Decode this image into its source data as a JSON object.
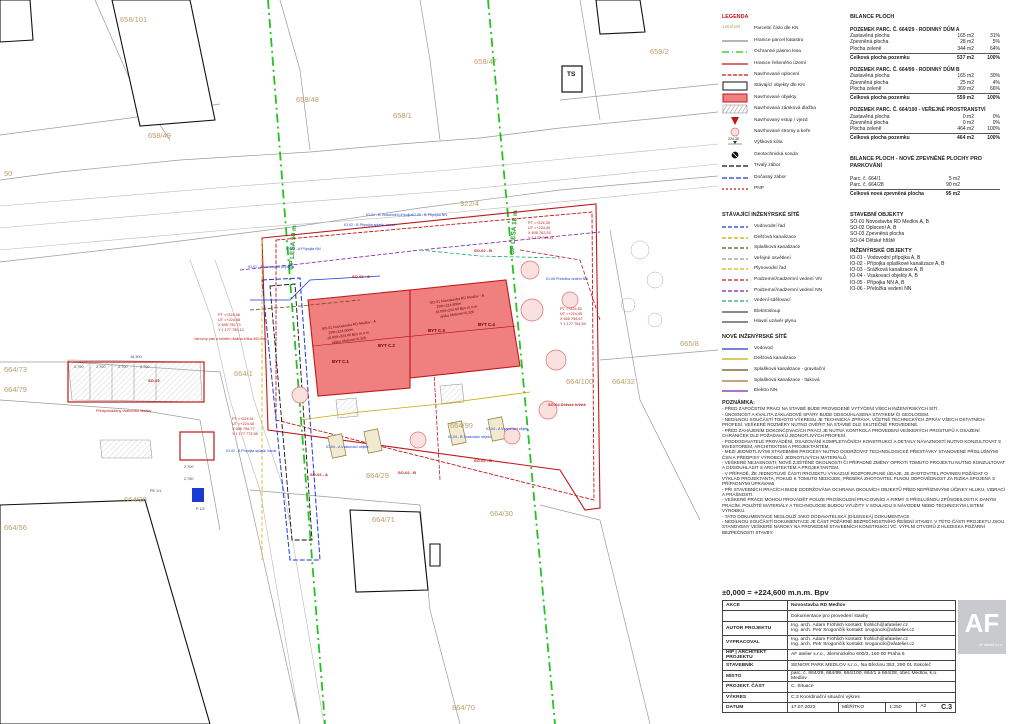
{
  "plan": {
    "parcels": [
      "658/101",
      "658/47",
      "659/2",
      "658/48",
      "658/1",
      "658/49",
      "322/4",
      "664/73",
      "664/79",
      "664/1",
      "664/100",
      "664/32",
      "665/8",
      "664/29",
      "664/99",
      "664/28",
      "664/56",
      "664/71",
      "664/30",
      "664/70"
    ],
    "edge_labels": {
      "left": "50"
    },
    "forest_labels": [
      "OP LESA 50 m",
      "OP LESA 18 m"
    ],
    "ts_label": "TS",
    "building_units": [
      "BYT C.1",
      "BYT C.2",
      "BYT C.3",
      "BYT C.4"
    ],
    "building_a": [
      "SO-01 Novostavba RD Medlov - A",
      "ZPP=224,600m",
      "±0,000=224,60 Bpv m.n.m.",
      "výška hřebene=6,326"
    ],
    "building_b": [
      "SO-01 Novostavba RD Medlov - B",
      "ZPP=224,600m",
      "±0,000=224,60 Bpv m.n.m.",
      "výška hřebene=6,326"
    ],
    "so_labels": [
      "SO-02 - B",
      "SO-02 - A",
      "SO-03",
      "SO-04 Dětské hřiště",
      "SO-02 - A",
      "SO-02 - B",
      "SO-02 - B"
    ],
    "io_labels": [
      "IO-01 - B Vodovodní přípojka",
      "IO-05 - B Přípojka NN",
      "IO-02 - B Přípojka splašk. kanal.",
      "IO-05 - A Přípojka NN",
      "IO-01 - A Vodovodní přípojka",
      "IO-06 Přeložka vedení NN",
      "IO-02 - A Přípojka splašk. kanal.",
      "IO-04 - A Vsakovací objekt",
      "IO-04 - B Vsakovací objekt",
      "IO-04 - A Vsakovací objekt"
    ],
    "coords_left": [
      "PT =+224,56",
      "UT =+224,58",
      "X 605 790,73",
      "Y 1 177 750,10"
    ],
    "coords_top": [
      "PT =+224,35",
      "UT =+224,40",
      "X 605 762,53",
      "Y 1 177 743,41"
    ],
    "coords_right": [
      "PT =+224,52",
      "UT =+224,45",
      "X 605 759,67",
      "Y 1 177 754,59"
    ],
    "coords_bottom": [
      "PT =+224,51",
      "UT =+224,45",
      "X 605 796,77",
      "Y 1 177 773,98"
    ],
    "parking_note": "Varovný pás a reliéfní dlažba šířka 400 mm",
    "parking_note_2": "Předpokládaný vsakovací dlažby",
    "dims": [
      "16,300",
      "2,700",
      "2,700",
      "2,700",
      "2,700",
      "2,700",
      "2,750",
      "PE 1/1",
      "P 1/2"
    ]
  },
  "legend": {
    "title": "LEGENDA",
    "items": [
      {
        "label": "Parcelní číslo dle KN",
        "sym": "text",
        "text": "1203/184"
      },
      {
        "label": "Hranice parcel katastru",
        "sym": "line",
        "color": "#8a8a8a",
        "dash": ""
      },
      {
        "label": "Ochranné pásmo lesa",
        "sym": "line",
        "color": "#22c322",
        "dash": "7 3 1 3"
      },
      {
        "label": "Hranice řešeného území",
        "sym": "line",
        "color": "#c01818",
        "dash": ""
      },
      {
        "label": "Navrhované oplocení",
        "sym": "line",
        "color": "#c01818",
        "dash": "4 1.5"
      },
      {
        "label": "Stávající objekty dle KN",
        "sym": "rect",
        "fill": "#ffffff",
        "stroke": "#111"
      },
      {
        "label": "Navrhované objekty",
        "sym": "rect",
        "fill": "#f08080",
        "stroke": "#c01818"
      },
      {
        "label": "Navrhovaná zámková dlažba",
        "sym": "hatch",
        "color": "#999"
      },
      {
        "label": "Navrhovaný vstup / vjezd",
        "sym": "arrow",
        "color": "#c01818"
      },
      {
        "label": "Navrhované stromy a keře",
        "sym": "tree",
        "color": "#e07070"
      },
      {
        "label": "Výšková kóta",
        "sym": "kota",
        "text": "224,35"
      },
      {
        "label": "Geotechnická sonda",
        "sym": "sonda"
      },
      {
        "label": "Trvalý zábor",
        "sym": "line",
        "color": "#111",
        "dash": "5 2"
      },
      {
        "label": "Dočasný zábor",
        "sym": "line",
        "color": "#1a3ad1",
        "dash": "5 2"
      },
      {
        "label": "PNP",
        "sym": "line",
        "color": "#c01818",
        "dash": "2 2"
      }
    ]
  },
  "balance": {
    "title": "BILANCE PLOCH",
    "groups": [
      {
        "head": "POZEMEK PARC. Č. 664/29 - RODINNÝ DŮM A",
        "rows": [
          [
            "Zastavěná plocha",
            "165 m2",
            "31%"
          ],
          [
            "Zpevněná plocha",
            "28 m2",
            "5%"
          ],
          [
            "Plocha zeleně",
            "344 m2",
            "64%"
          ]
        ],
        "total": [
          "Celková plocha pozemku",
          "537 m2",
          "100%"
        ]
      },
      {
        "head": "POZEMEK PARC. Č. 664/99 - RODINNÝ DŮM B",
        "rows": [
          [
            "Zastavěná plocha",
            "165 m2",
            "30%"
          ],
          [
            "Zpevněná plocha",
            "25 m2",
            "4%"
          ],
          [
            "Plocha zeleně",
            "369 m2",
            "66%"
          ]
        ],
        "total": [
          "Celková plocha pozemku",
          "559 m2",
          "100%"
        ]
      },
      {
        "head": "POZEMEK PARC. Č. 664/100 - VEŘEJNÉ PROSTRANSTVÍ",
        "rows": [
          [
            "Zastavěná plocha",
            "0 m2",
            "0%"
          ],
          [
            "Zpevněná plocha",
            "0 m2",
            "0%"
          ],
          [
            "Plocha zeleně",
            "464 m2",
            "100%"
          ]
        ],
        "total": [
          "Celková plocha pozemku",
          "464 m2",
          "100%"
        ]
      }
    ]
  },
  "parking_balance": {
    "title": "BILANCE PLOCH - NOVÉ ZPEVNĚNÉ PLOCHY PRO PARKOVÁNÍ",
    "rows": [
      [
        "Parc. č. 664/1",
        "5 m2"
      ],
      [
        "Parc. č. 664/28",
        "90 m2"
      ]
    ],
    "total": [
      "Celková nová zpevněná plocha",
      "95 m2"
    ]
  },
  "existing_networks": {
    "title": "STÁVAJÍCÍ INŽENÝRSKÉ SÍTĚ",
    "items": [
      {
        "label": "Vodovodní řad",
        "color": "#1a3ad1",
        "dash": "4 2"
      },
      {
        "label": "Dešťová kanalizace",
        "color": "#c9a800",
        "dash": "4 2"
      },
      {
        "label": "Splašková kanalizace",
        "color": "#6b4b1a",
        "dash": "4 2"
      },
      {
        "label": "Veřejné osvětlení",
        "color": "#999",
        "dash": "4 2"
      },
      {
        "label": "Plynovodní řad",
        "color": "#d8b400",
        "dash": "4 2"
      },
      {
        "label": "Podzemní/nadzemní vedení VN",
        "color": "#c01818",
        "dash": "4 2"
      },
      {
        "label": "Podzemní/nadzemní vedení NN",
        "color": "#7a1fb0",
        "dash": "4 2"
      },
      {
        "label": "Vedení sdělovací",
        "color": "#1fa37a",
        "dash": "4 2"
      },
      {
        "label": "Elektrosloup",
        "color": "#444",
        "dash": ""
      },
      {
        "label": "Hlavní uzávěr plynu",
        "color": "#444",
        "dash": ""
      }
    ]
  },
  "new_networks": {
    "title": "NOVÉ INŽENÝRSKÉ SÍTĚ",
    "items": [
      {
        "label": "Vodovod",
        "color": "#1a3ad1"
      },
      {
        "label": "Dešťová kanalizace",
        "color": "#c9a800"
      },
      {
        "label": "Splašková kanalizace - gravitační",
        "color": "#6b4b1a"
      },
      {
        "label": "Splašková kanalizace - tlaková",
        "color": "#a0702a"
      },
      {
        "label": "Elektro NN",
        "color": "#7a1fb0"
      }
    ]
  },
  "objects": {
    "title": "STAVEBNÍ OBJEKTY",
    "items": [
      "SO-01 Novostavba RD Medlov A, B",
      "SO-02 Oplocení A, B",
      "SO-03 Zpevněná plocha",
      "SO-04 Dětské hřiště"
    ],
    "title2": "INŽENÝRSKÉ OBJEKTY",
    "items2": [
      "IO-01 - Vodovodní přípojka A, B",
      "IO-02 - Přípojka splaškové kanalizace A, B",
      "IO-03 - Srážková kanalizace A, B",
      "IO-04 - Vsakovací objekty A, B",
      "IO-05 - Přípojka NN A, B",
      "IO-06 - Přeložka vedení NN"
    ]
  },
  "notes": {
    "title": "POZNÁMKA:",
    "lines": [
      "- PŘED ZAPOČETÍM PRACÍ NA STAVBĚ BUDE PROVEDENÉ VYTÝČENÍ VŠECH INŽENÝRSKÝCH SÍTÍ.",
      "- ÚNOSNOST A KVALITA ZÁKLADOVÉ SPÁRY BUDE ODSOUHLASENA STATIKEM ČI GEOLOGEM.",
      "- NEDÍLNOU SOUČÁSTÍ TOHOTO VÝKRESU JE TECHNICKÁ ZPRÁVA, VČETNĚ TECHNICKÝCH ZPRÁV VŠECH OSTATNÍCH PROFESÍ. VEŠKERÉ ROZMĚRY NUTNO OVĚŘIT NA STAVBĚ DLE SKUTEČNĚ PROVEDENÉ.",
      "- PŘED ZAHÁJENÍM DOKONČOVACÍCH PRACÍ JE NUTNÁ KONTROLA PROVEDENÍ VEŠKERÝCH PROSTUPŮ A OSAZENÍ CHRÁNIČEK DLE POŽADAVKŮ JEDNOTLIVÝCH PROFESÍ.",
      "- PODDODAVATELÉ PROVÁDĚNÍ, OSAZOVÁNÍ KOMPLETAČNÍCH KONSTRUKCÍ A DETAILY NÁVAZNOSTÍ NUTNO KONZULTOVAT S INVESTOREM, ARCHITEKTEM A PROJEKTANTEM.",
      "- MEZI JEDNOTLIVÝMI STAVEBNÍMI PROCESY NUTNO DODRŽOVAT TECHNOLOGICKÉ PŘESTÁVKY STANOVENÉ PŘÍSLUŠNÝMI ČSN A PŘEDPISY VÝROBCŮ JEDNOTLIVÝCH MATERIÁLŮ.",
      "- VEŠKERÉ NEJASNOSTI, NOVĚ ZJIŠTĚNÉ OKOLNOSTI ČI PŘÍPADNÉ ZMĚNY OPROTI TOMUTO PROJEKTU NUTNO KONZULTOVAT A ODSOUHLASIT S ARCHITEKTEM A PROJEKTANTEM.",
      "- V PŘÍPADĚ, ŽE JEDNOTLIVÉ ČÁSTI PROJEKTU VYKAZUJÍ ROZPORUPLNÉ ÚDAJE, JE ZHOTOVITEL POVINEN POŽÁDAT O VÝKLAD PROJEKTANTA, POKUD K TOMUTO NEDOJDE, PŘEBÍRÁ ZHOTOVITEL PLNOU ODPOVĚDNOST ZA RIZIKA SPOJENÁ S PŘÍPADNÝMI ÚPRAVAMI.",
      "- PŘI STAVEBNÍCH PRACÍCH BUDE DODRŽOVÁNA OCHRANA OKOLNÍCH OBJEKTŮ PŘED NEPŘÍZNIVÝMI ÚČINKY HLUKU, VIBRACÍ A PRAŠNOSTI.",
      "- VEŠKERÉ PRÁCE MOHOU PROVÁDĚT POUZE PROŠKOLENÍ PRACOVNÍCI A FIRMY S PŘÍSLUŠNOU ZPŮSOBILOSTÍ K DANÝM PRACÍM. POUŽITÉ MATERIÁLY A TECHNOLOGIE BUDOU VYUŽITY V SOULADU S NÁVODEM NEBO TECHNICKÝM LISTEM VÝROBKU.",
      "- TATO DOKUMENTACE NESLOUŽÍ JAKO DODAVATELSKÁ (DÍLENSKÁ) DOKUMENTACE.",
      "- NEDÍLNOU SOUČÁSTÍ DOKUMENTACE JE ČÁST POŽÁRNĚ BEZPEČNOSTNÍHO ŘEŠENÍ STAVBY. V TÉTO ČÁSTI PROJEKTU JSOU STANOVENY VEŠKERÉ NÁROKY NA PROVEDENÍ STAVEBNÍCH KONSTRUKCÍ VČ. VÝPLNÍ OTVORŮ Z HLEDISKA POŽÁRNÍ BEZPEČNOSTI STAVBY."
    ]
  },
  "title_block": {
    "elevation": "±0,000 = +224,600 m.n.m. Bpv",
    "rows": [
      {
        "key": "AKCE",
        "value": "Novostavba RD Medlov",
        "bold": true
      },
      {
        "key": "",
        "value": "Dokumentace pro provedení stavby"
      },
      {
        "key": "AUTOR PROJEKTU",
        "value": "Ing. arch. Adam Fröhlich     kontakt: frohlich@afatelier.cz",
        "value2": "Ing. arch. Petr Srogončík     kontakt: srogoncik@afatelier.cz"
      },
      {
        "key": "VYPRACOVAL",
        "value": "Ing. arch. Adam Fröhlich     kontakt: frohlich@afatelier.cz",
        "value2": "Ing. arch. Petr Srogončík     kontakt: srogoncik@afatelier.cz"
      },
      {
        "key": "HIP | ARCHITEKT PROJEKTU",
        "value": "AF atelier s.r.o., Jilemnického 600/3, 160 00 Praha 6"
      },
      {
        "key": "STAVEBNÍK",
        "value": "SENIOR PARK MEDLOV s.r.o., Na Březinu 353, 290 01 Sokoleč"
      },
      {
        "key": "MÍSTO",
        "value": "parc. č. 664/29, 664/99, 664/100, 664/1 a 664/28, obec Medlov, k.ú. Medlov"
      },
      {
        "key": "PROJEKT. ČÁST",
        "value": "C. Situace"
      },
      {
        "key": "VÝKRES",
        "value": "C.3 Koordinační situační výkres"
      }
    ],
    "date_label": "DATUM",
    "date": "17.07.2023",
    "scale_label": "MĚŘÍTKO",
    "scale": "1:250",
    "format": "A2",
    "sheet": "C.3",
    "logo_text": "AF",
    "logo_sub": "AF atelier s.r.o."
  }
}
